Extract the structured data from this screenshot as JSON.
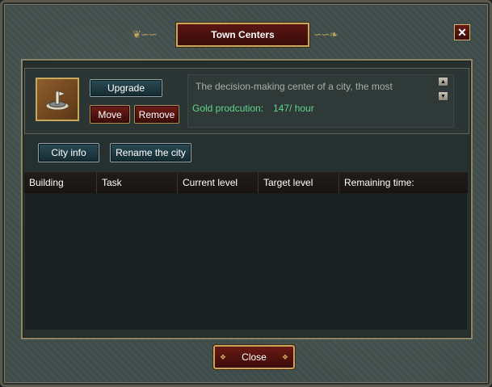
{
  "window": {
    "title": "Town Centers",
    "close_glyph": "✕"
  },
  "building": {
    "icon": "town-center-icon",
    "actions": {
      "upgrade": "Upgrade",
      "move": "Move",
      "remove": "Remove"
    },
    "description": "The decision-making center of a city, the most",
    "gold_label": "Gold prodcution:",
    "gold_value": "147/ hour"
  },
  "tabs": {
    "city_info": "City info",
    "rename": "Rename the city"
  },
  "table": {
    "columns": [
      "Building",
      "Task",
      "Current level",
      "Target level",
      "Remaining time:"
    ],
    "rows": []
  },
  "footer": {
    "close_label": "Close"
  },
  "colors": {
    "accent_gold": "#c9a55a",
    "green_text": "#61d48a",
    "title_red": "#5a1612"
  }
}
